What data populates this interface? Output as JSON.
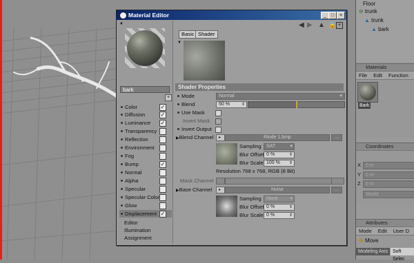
{
  "right_panel": {
    "tree": [
      {
        "label": "Floor"
      },
      {
        "label": "trunk"
      },
      {
        "label": "trunk"
      },
      {
        "label": "bark"
      }
    ],
    "materials_title": "Materials",
    "materials_menu": [
      "File",
      "Edit",
      "Function"
    ],
    "material_thumb_label": "Bark",
    "coordinates_title": "Coordinates",
    "coord_labels": [
      "X",
      "Y",
      "Z"
    ],
    "coord_values": [
      "0 m",
      "0 m",
      "0 m"
    ],
    "coord_mode": "World",
    "attributes_title": "Attributes",
    "attributes_menu": [
      "Mode",
      "Edit",
      "User D"
    ],
    "move_label": "Move",
    "bottom_tabs": [
      "Modeling Axis",
      "Soft Selec"
    ]
  },
  "window": {
    "title": "Material Editor",
    "btn_min": "_",
    "btn_max": "□",
    "btn_close": "×"
  },
  "material_name": "bark",
  "expand_btn": "+",
  "channels": [
    {
      "label": "Color",
      "checked": "✓"
    },
    {
      "label": "Diffusion",
      "checked": "✓"
    },
    {
      "label": "Luminance",
      "checked": "✓"
    },
    {
      "label": "Transparency",
      "checked": ""
    },
    {
      "label": "Reflection",
      "checked": ""
    },
    {
      "label": "Environment",
      "checked": ""
    },
    {
      "label": "Fog",
      "checked": ""
    },
    {
      "label": "Bump",
      "checked": "✓"
    },
    {
      "label": "Normal",
      "checked": ""
    },
    {
      "label": "Alpha",
      "checked": ""
    },
    {
      "label": "Specular",
      "checked": ""
    },
    {
      "label": "Specular Color",
      "checked": ""
    },
    {
      "label": "Glow",
      "checked": ""
    },
    {
      "label": "Displacement",
      "checked": "✓"
    }
  ],
  "extra_items": [
    "Editor",
    "Illumination",
    "Assignment"
  ],
  "tabs": [
    "Basic",
    "Shader"
  ],
  "shader_properties_title": "Shader Properties",
  "props": {
    "mode_label": "Mode",
    "mode_value": "Normal",
    "blend_label": "Blend",
    "blend_value": "50 %",
    "blend_fraction": 0.5,
    "use_mask": "Use Mask",
    "invert_mask": "Invert Mask",
    "invert_output": "Invert Output",
    "blend_channel_label": "Blend Channel",
    "blend_channel_file": "Rinde 1.bmp",
    "sampling_label": "Sampling",
    "sampling_value": "SAT",
    "blur_offset_label": "Blur Offset",
    "blur_offset_value": "0 %",
    "blur_scale_label": "Blur Scale",
    "blur_scale_value": "100 %",
    "resolution": "Resolution 768 x 768, RGB (8 Bit)",
    "mask_channel_label": "Mask Channel",
    "base_channel_label": "Base Channel",
    "base_channel_value": "Noise",
    "sampling2_label": "Sampling",
    "sampling2_value": "None",
    "blur_offset2_label": "Blur Offset",
    "blur_offset2_value": "0 %",
    "blur_scale2_label": "Blur Scale",
    "blur_scale2_value": "0 %"
  },
  "colors": {
    "titlebar": "#0a246a",
    "accent_marker": "#e0a020"
  }
}
